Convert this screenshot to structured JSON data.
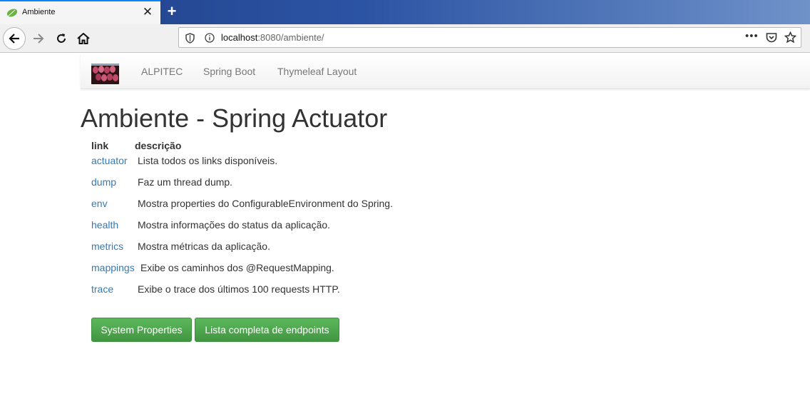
{
  "browser": {
    "tab_title": "Ambiente",
    "tab_close": "✕",
    "new_tab": "+",
    "url_host": "localhost",
    "url_rest": ":8080/ambiente/",
    "url_more": "•••"
  },
  "navbar": {
    "links": [
      "ALPITEC",
      "Spring Boot",
      "Thymeleaf Layout"
    ]
  },
  "page": {
    "title": "Ambiente - Spring Actuator",
    "table_headers": {
      "link": "link",
      "description": "descrição"
    },
    "endpoints": [
      {
        "link": "actuator",
        "description": "Lista todos os links disponíveis."
      },
      {
        "link": "dump",
        "description": "Faz um thread dump."
      },
      {
        "link": "env",
        "description": "Mostra properties do ConfigurableEnvironment do Spring."
      },
      {
        "link": "health",
        "description": "Mostra informações do status da aplicação."
      },
      {
        "link": "metrics",
        "description": "Mostra métricas da aplicação."
      },
      {
        "link": "mappings",
        "description": "Exibe os caminhos dos @RequestMapping."
      },
      {
        "link": "trace",
        "description": "Exibe o trace dos últimos 100 requests HTTP."
      }
    ],
    "buttons": {
      "system_properties": "System Properties",
      "all_endpoints": "Lista completa de endpoints"
    }
  },
  "colors": {
    "link": "#337ab7",
    "button_green": "#5cb85c",
    "tab_accent": "#0a84ff"
  }
}
